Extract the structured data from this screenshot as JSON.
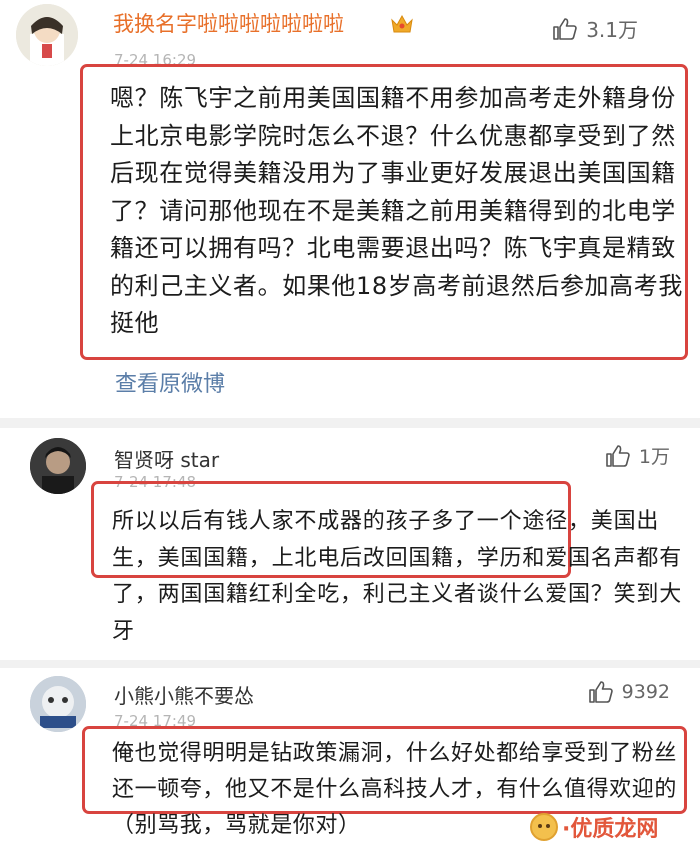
{
  "comments": [
    {
      "username": "我换名字啦啦啦啦啦啦啦",
      "time": "7-24 16:29",
      "likes": "3.1万",
      "text": "嗯？陈飞宇之前用美国国籍不用参加高考走外籍身份上北京电影学院时怎么不退？什么优惠都享受到了然后现在觉得美籍没用为了事业更好发展退出美国国籍了？请问那他现在不是美籍之前用美籍得到的北电学籍还可以拥有吗？北电需要退出吗？陈飞宇真是精致的利己主义者。如果他18岁高考前退然后参加高考我挺他",
      "view_original": "查看原微博"
    },
    {
      "username": "智贤呀 star",
      "time": "7-24 17:48",
      "likes": "1万",
      "text": "所以以后有钱人家不成器的孩子多了一个途径，美国出生，美国国籍，上北电后改回国籍，学历和爱国名声都有了，两国国籍红利全吃，利己主义者谈什么爱国？笑到大牙"
    },
    {
      "username": "小熊小熊不要怂",
      "time": "7-24 17:49",
      "likes": "9392",
      "text": "俺也觉得明明是钻政策漏洞，什么好处都给享受到了粉丝还一顿夸，他又不是什么高科技人才，有什么值得欢迎的（别骂我，骂就是你对）"
    }
  ],
  "watermark": {
    "text": "·优质龙网"
  },
  "icons": {
    "like": "thumbs-up-icon",
    "vip": "crown-icon",
    "watermark": "emoji-face-icon"
  },
  "colors": {
    "highlight_border": "#d8443f",
    "vip_username": "#e8702a",
    "link": "#5b7ea8"
  }
}
